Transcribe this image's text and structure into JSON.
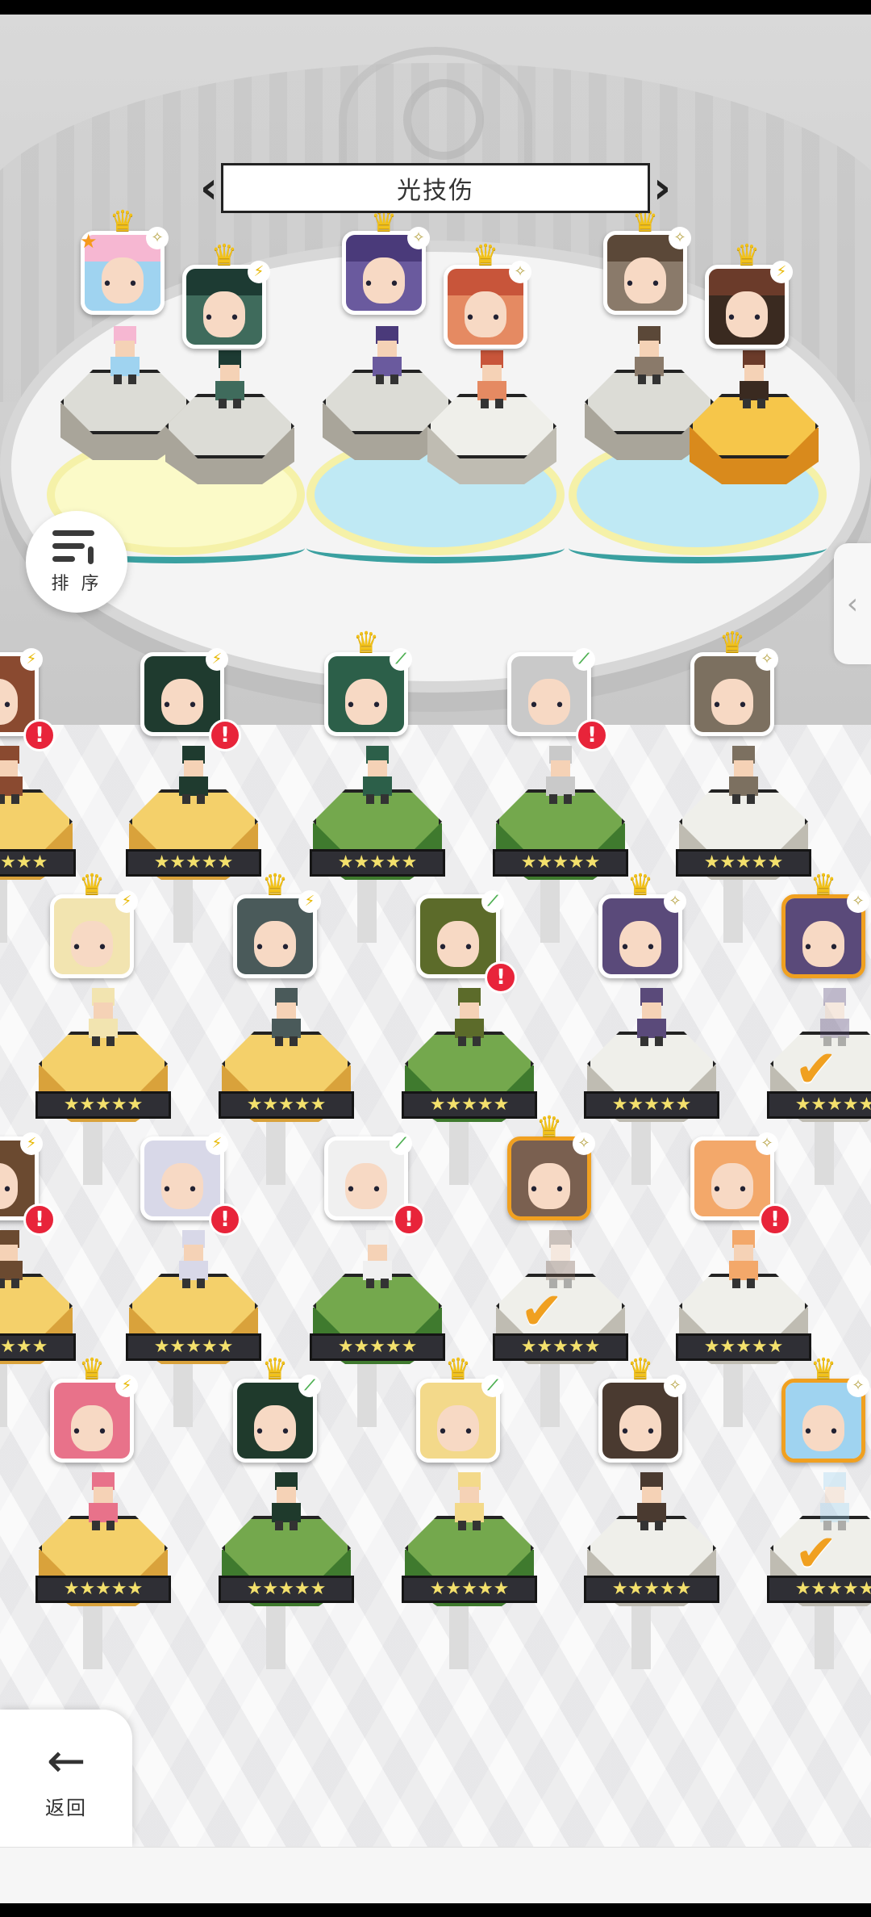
{
  "header": {
    "title": "光技伤",
    "prev_icon": "chevron-left-icon",
    "next_icon": "chevron-right-icon"
  },
  "sort_button": {
    "label": "排 序",
    "icon": "sort-descending-icon"
  },
  "back_button": {
    "label": "返回",
    "icon": "arrow-left-icon"
  },
  "side_tab": {
    "icon": "chevron-left-icon"
  },
  "colors": {
    "gold": "#f4d06a",
    "green": "#74a84d",
    "white": "#efefea",
    "alert": "#e8243a",
    "selected": "#f0a020",
    "crown": "#f2c21a"
  },
  "stars": "★★★★★",
  "team": [
    {
      "elem": "✧",
      "face": "#9fd3f0",
      "hair": "#f6b7d2",
      "mark": "★"
    },
    {
      "elem": "⚡",
      "face": "#3f6b5c",
      "hair": "#1d3b33"
    },
    {
      "elem": "✧",
      "face": "#6a5a9e",
      "hair": "#4a3a7a"
    },
    {
      "elem": "✧",
      "face": "#e58a62",
      "hair": "#c8553a"
    },
    {
      "elem": "✧",
      "face": "#8a7a6a",
      "hair": "#5b4838"
    },
    {
      "elem": "⚡",
      "face": "#3a2a20",
      "hair": "#6b3b2a"
    }
  ],
  "roster": [
    [
      {
        "elem": "⚡",
        "face": "#8a4a30",
        "ped": "gold",
        "alert": "!"
      },
      {
        "elem": "⚡",
        "face": "#1f3b2f",
        "ped": "gold",
        "alert": "!"
      },
      {
        "elem": "⟋",
        "face": "#2c5f49",
        "ped": "green",
        "crown": true
      },
      {
        "elem": "⟋",
        "face": "#c9c9c9",
        "ped": "green",
        "alert": "!"
      },
      {
        "elem": "✧",
        "face": "#7c7060",
        "ped": "white",
        "crown": true
      }
    ],
    [
      {
        "elem": "⚡",
        "face": "#f2e4b0",
        "ped": "gold",
        "crown": true
      },
      {
        "elem": "⚡",
        "face": "#4a5a5a",
        "ped": "gold",
        "crown": true
      },
      {
        "elem": "⟋",
        "face": "#5c6b2a",
        "ped": "green",
        "alert": "!"
      },
      {
        "elem": "✧",
        "face": "#5a4a7a",
        "ped": "white",
        "crown": true
      },
      {
        "elem": "✧",
        "face": "#5a4a7a",
        "ped": "white",
        "crown": true,
        "selected": true,
        "check": "✔"
      }
    ],
    [
      {
        "elem": "⚡",
        "face": "#6b4a30",
        "ped": "gold",
        "alert": "!"
      },
      {
        "elem": "⚡",
        "face": "#d8d8e8",
        "ped": "gold",
        "alert": "!"
      },
      {
        "elem": "⟋",
        "face": "#f0f0f0",
        "ped": "green",
        "alert": "!"
      },
      {
        "elem": "✧",
        "face": "#7a6050",
        "ped": "white",
        "crown": true,
        "selected": true,
        "check": "✔"
      },
      {
        "elem": "✧",
        "face": "#f3a86a",
        "ped": "white",
        "alert": "!"
      }
    ],
    [
      {
        "elem": "⚡",
        "face": "#e8728a",
        "ped": "gold",
        "crown": true
      },
      {
        "elem": "⟋",
        "face": "#1f3a2c",
        "ped": "green",
        "crown": true
      },
      {
        "elem": "⟋",
        "face": "#f3d98a",
        "ped": "green",
        "crown": true
      },
      {
        "elem": "✧",
        "face": "#4a3a30",
        "ped": "white",
        "crown": true
      },
      {
        "elem": "✧",
        "face": "#9fd3f0",
        "ped": "white",
        "crown": true,
        "selected": true,
        "check": "✔"
      }
    ]
  ]
}
